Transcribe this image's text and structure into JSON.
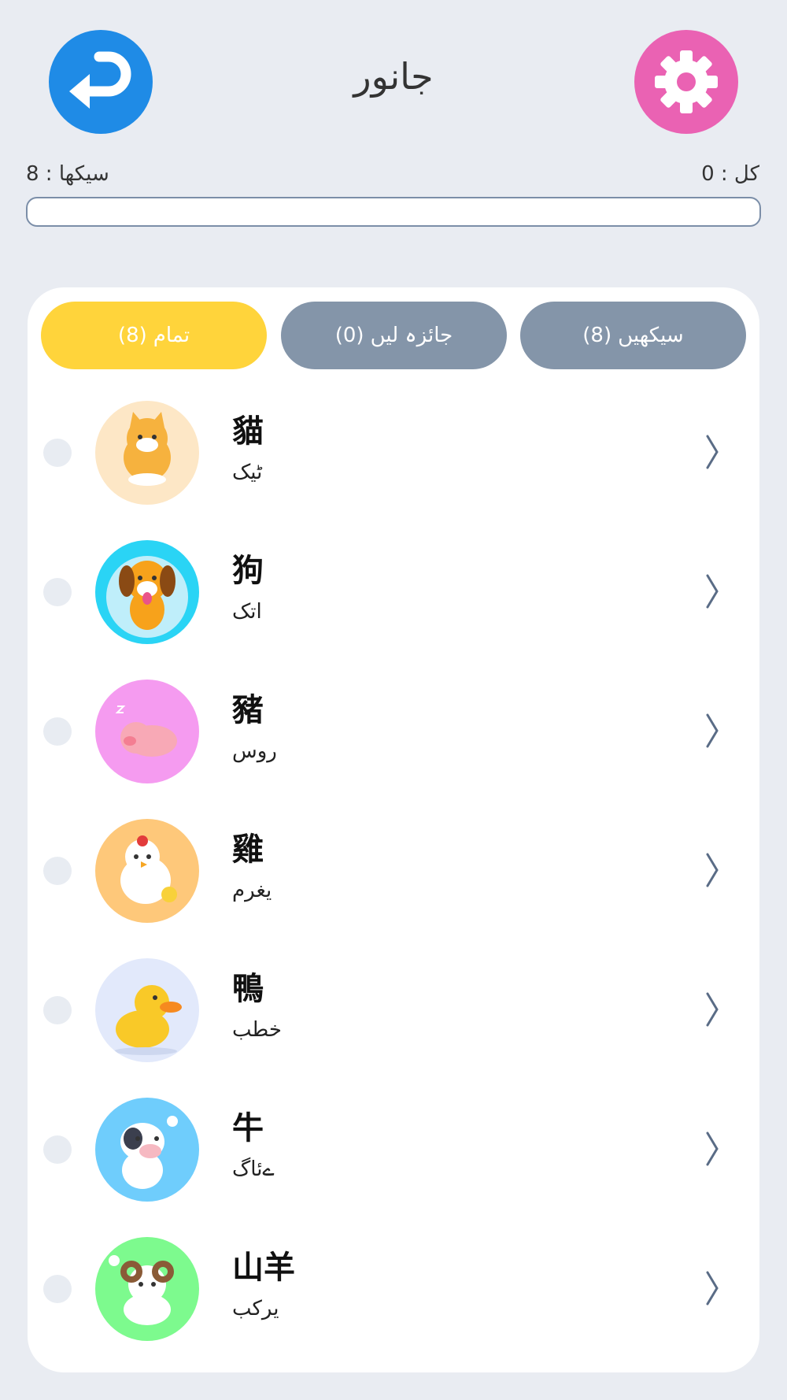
{
  "header": {
    "title": "جانور",
    "back_icon": "back-arrow-icon",
    "settings_icon": "gear-icon"
  },
  "stats": {
    "learned_label": "8 : سیکھا",
    "total_label": "0 : کل"
  },
  "progress": {
    "value": 0
  },
  "tabs": [
    {
      "count": "(8)",
      "label": "تمام",
      "active": true
    },
    {
      "count": "(0)",
      "label": "جائزہ لیں",
      "active": false
    },
    {
      "count": "(8)",
      "label": "سیکھیں",
      "active": false
    }
  ],
  "items": [
    {
      "word": "貓",
      "translation": "ٹیک",
      "avatar_bg": "#fde7c6",
      "icon": "cat-icon"
    },
    {
      "word": "狗",
      "translation": "اتک",
      "avatar_bg": "#2ad4f5",
      "icon": "dog-icon"
    },
    {
      "word": "豬",
      "translation": "روس",
      "avatar_bg": "#f59bf0",
      "icon": "pig-icon"
    },
    {
      "word": "雞",
      "translation": "یغرم",
      "avatar_bg": "#fec87a",
      "icon": "chicken-icon"
    },
    {
      "word": "鴨",
      "translation": "خطب",
      "avatar_bg": "#e2e9fb",
      "icon": "duck-icon"
    },
    {
      "word": "牛",
      "translation": "ےئاگ",
      "avatar_bg": "#6fcdfc",
      "icon": "cow-icon"
    },
    {
      "word": "山羊",
      "translation": "یرکب",
      "avatar_bg": "#7dfa8e",
      "icon": "goat-icon"
    }
  ],
  "colors": {
    "background": "#e9ecf2",
    "back_button": "#1f8be6",
    "settings_button": "#ea62b3",
    "tab_active": "#ffd43b",
    "tab_inactive": "#8495a9"
  }
}
